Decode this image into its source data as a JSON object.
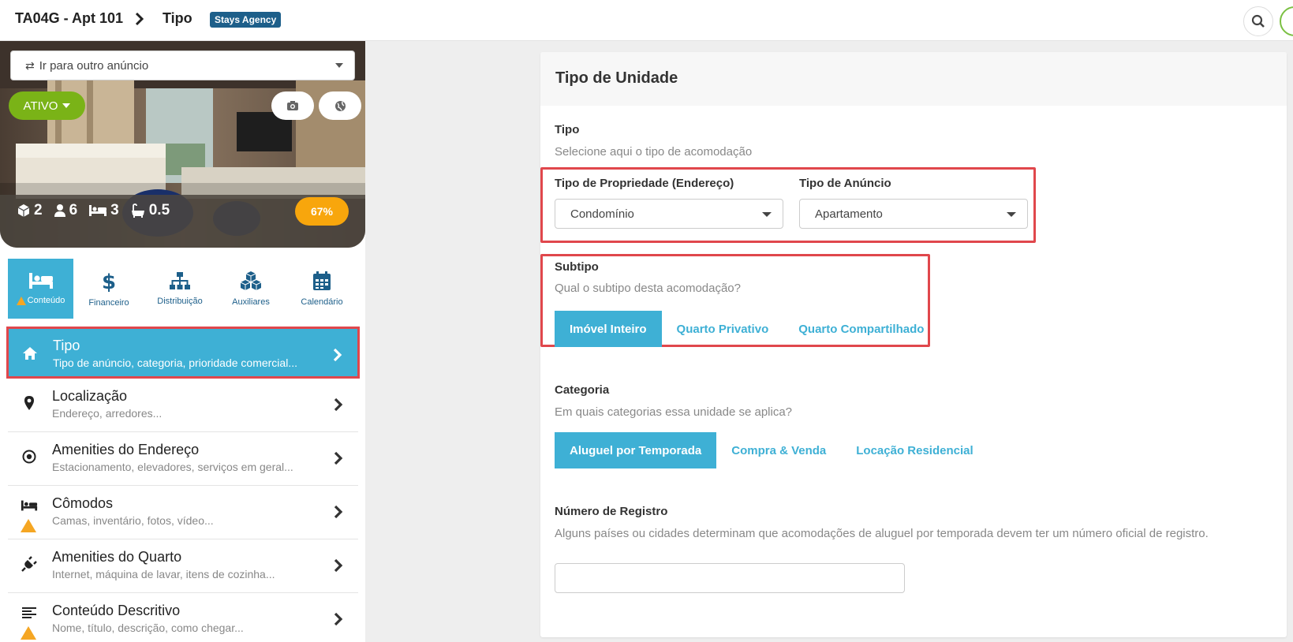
{
  "header": {
    "breadcrumb_listing": "TA04G - Apt 101",
    "breadcrumb_page": "Tipo",
    "agency_badge": "Stays Agency"
  },
  "sidebar": {
    "goto_listing": "Ir para outro anúncio",
    "status": "ATIVO",
    "stats": {
      "units": "2",
      "guests": "6",
      "beds": "3",
      "baths": "0.5"
    },
    "completion": "67%",
    "tabs": [
      {
        "label": "Conteúdo",
        "icon": "bed-icon",
        "active": true,
        "warning": true
      },
      {
        "label": "Financeiro",
        "icon": "dollar-icon"
      },
      {
        "label": "Distribuição",
        "icon": "sitemap-icon"
      },
      {
        "label": "Auxiliares",
        "icon": "cubes-icon"
      },
      {
        "label": "Calendário",
        "icon": "calendar-icon"
      }
    ],
    "menu": [
      {
        "title": "Tipo",
        "subtitle": "Tipo de anúncio, categoria, prioridade comercial...",
        "icon": "home-icon",
        "active": true
      },
      {
        "title": "Localização",
        "subtitle": "Endereço, arredores...",
        "icon": "map-pin-icon"
      },
      {
        "title": "Amenities do Endereço",
        "subtitle": "Estacionamento, elevadores, serviços em geral...",
        "icon": "target-icon"
      },
      {
        "title": "Cômodos",
        "subtitle": "Camas, inventário, fotos, vídeo...",
        "icon": "bed-icon",
        "warning": true
      },
      {
        "title": "Amenities do Quarto",
        "subtitle": "Internet, máquina de lavar, itens de cozinha...",
        "icon": "plug-icon"
      },
      {
        "title": "Conteúdo Descritivo",
        "subtitle": "Nome, título, descrição, como chegar...",
        "icon": "align-left-icon",
        "warning": true
      }
    ]
  },
  "main": {
    "card_title": "Tipo de Unidade",
    "tipo": {
      "label": "Tipo",
      "help": "Selecione aqui o tipo de acomodação",
      "property_type_label": "Tipo de Propriedade (Endereço)",
      "property_type_value": "Condomínio",
      "listing_type_label": "Tipo de Anúncio",
      "listing_type_value": "Apartamento"
    },
    "subtipo": {
      "label": "Subtipo",
      "help": "Qual o subtipo desta acomodação?",
      "options": [
        "Imóvel Inteiro",
        "Quarto Privativo",
        "Quarto Compartilhado"
      ],
      "selected": "Imóvel Inteiro"
    },
    "categoria": {
      "label": "Categoria",
      "help": "Em quais categorias essa unidade se aplica?",
      "options": [
        "Aluguel por Temporada",
        "Compra & Venda",
        "Locação Residencial"
      ],
      "selected": "Aluguel por Temporada"
    },
    "registro": {
      "label": "Número de Registro",
      "help": "Alguns países ou cidades determinam que acomodações de aluguel por temporada devem ter um número oficial de registro.",
      "value": ""
    }
  },
  "colors": {
    "accent": "#3eb0d5",
    "brand_dark": "#1d5f8a",
    "status_green": "#7ab317",
    "completion_orange": "#f8a60c",
    "highlight_red": "#e0474c",
    "warning": "#f5a623"
  }
}
